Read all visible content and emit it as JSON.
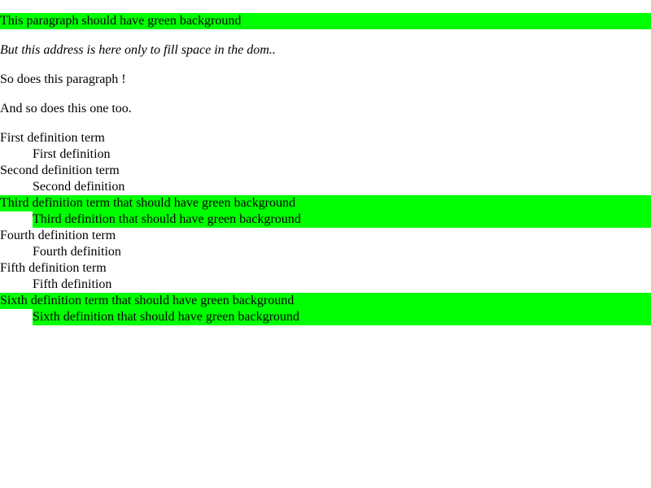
{
  "colors": {
    "highlight": "#00ff00",
    "text": "#000000",
    "background": "#ffffff"
  },
  "blocks": {
    "p1": "This paragraph should have green background",
    "address": "But this address is here only to fill space in the dom..",
    "p2": "So does this paragraph !",
    "p3": "And so does this one too."
  },
  "definitions": [
    {
      "term": "First definition term",
      "definition": "First definition"
    },
    {
      "term": "Second definition term",
      "definition": "Second definition"
    },
    {
      "term": "Third definition term that should have green background",
      "definition": "Third definition that should have green background"
    },
    {
      "term": "Fourth definition term",
      "definition": "Fourth definition"
    },
    {
      "term": "Fifth definition term",
      "definition": "Fifth definition"
    },
    {
      "term": "Sixth definition term that should have green background",
      "definition": "Sixth definition that should have green background"
    }
  ]
}
